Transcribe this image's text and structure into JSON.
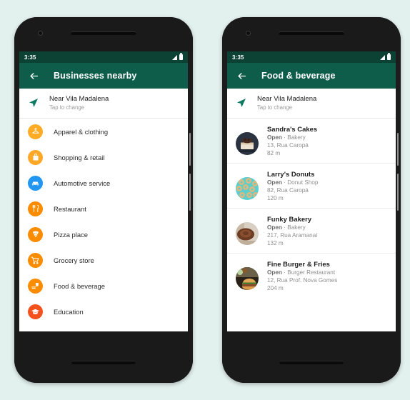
{
  "background_color": "#e2f0ee",
  "theme": {
    "statusbar_color": "#0b4234",
    "appbar_color": "#0e5c4a",
    "accent_teal": "#0e7a63"
  },
  "phones": [
    {
      "id": "left",
      "statusbar": {
        "time": "3:35",
        "signal_icon": "signal-icon",
        "battery_icon": "battery-icon"
      },
      "appbar": {
        "back_icon": "back-arrow-icon",
        "title": "Businesses nearby"
      },
      "location": {
        "icon": "navigation-arrow-icon",
        "title": "Near Vila Madalena",
        "subtitle": "Tap to change"
      },
      "categories": [
        {
          "label": "Apparel & clothing",
          "icon": "hanger-icon",
          "color": "#ffab24"
        },
        {
          "label": "Shopping & retail",
          "icon": "shopping-bag-icon",
          "color": "#ffa726"
        },
        {
          "label": "Automotive service",
          "icon": "car-icon",
          "color": "#2196f3"
        },
        {
          "label": "Restaurant",
          "icon": "cutlery-icon",
          "color": "#fb8c00"
        },
        {
          "label": "Pizza place",
          "icon": "pizza-slice-icon",
          "color": "#fb8c00"
        },
        {
          "label": "Grocery store",
          "icon": "shopping-cart-icon",
          "color": "#fb8c00"
        },
        {
          "label": "Food & beverage",
          "icon": "food-drink-icon",
          "color": "#fb8c00"
        },
        {
          "label": "Education",
          "icon": "graduation-cap-icon",
          "color": "#f4511e"
        }
      ],
      "navbar": {
        "back": "nav-back-icon",
        "home": "nav-home-icon",
        "recents": "nav-recents-icon"
      }
    },
    {
      "id": "right",
      "statusbar": {
        "time": "3:35",
        "signal_icon": "signal-icon",
        "battery_icon": "battery-icon"
      },
      "appbar": {
        "back_icon": "back-arrow-icon",
        "title": "Food & beverage"
      },
      "location": {
        "icon": "navigation-arrow-icon",
        "title": "Near Vila Madalena",
        "subtitle": "Tap to change"
      },
      "businesses": [
        {
          "name": "Sandra's Cakes",
          "status": "Open",
          "separator": "·",
          "category": "Bakery",
          "address": "13, Rua Caropá",
          "distance": "82 m",
          "thumb": "cake-photo"
        },
        {
          "name": "Larry's Donuts",
          "status": "Open",
          "separator": "·",
          "category": "Donut Shop",
          "address": "82, Rua Caropá",
          "distance": "120 m",
          "thumb": "donuts-photo"
        },
        {
          "name": "Funky Bakery",
          "status": "Open",
          "separator": "·",
          "category": "Bakery",
          "address": "217, Rua Aramanaí",
          "distance": "132 m",
          "thumb": "bread-photo"
        },
        {
          "name": "Fine Burger & Fries",
          "status": "Open",
          "separator": "·",
          "category": "Burger Restaurant",
          "address": "12, Rua Prof. Nova Gomes",
          "distance": "204 m",
          "thumb": "burger-photo"
        }
      ],
      "navbar": {
        "back": "nav-back-icon",
        "home": "nav-home-icon",
        "recents": "nav-recents-icon"
      }
    }
  ]
}
